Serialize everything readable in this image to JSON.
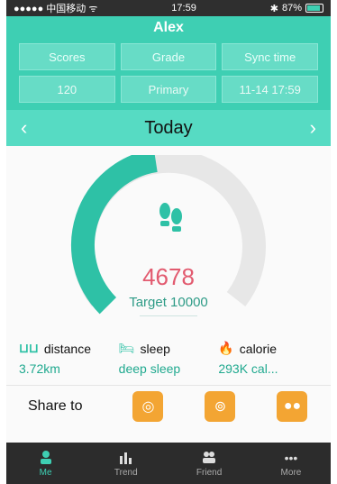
{
  "status": {
    "carrier": "●●●●● 中国移动 ᯤ",
    "time": "17:59",
    "battery": "87%"
  },
  "header": {
    "user": "Alex",
    "stats_headers": [
      "Scores",
      "Grade",
      "Sync time"
    ],
    "stats_values": [
      "120",
      "Primary",
      "11-14 17:59"
    ]
  },
  "date_bar": {
    "label": "Today",
    "prev": "‹",
    "next": "›"
  },
  "dashboard": {
    "steps": "4678",
    "target": "Target 10000",
    "progress_fraction": 0.468
  },
  "stats": {
    "distance": {
      "label": "distance",
      "value": "3.72km"
    },
    "sleep": {
      "label": "sleep",
      "value": "deep sleep"
    },
    "calorie": {
      "label": "calorie",
      "value": "293K cal..."
    }
  },
  "share": {
    "label": "Share to"
  },
  "tabbar": {
    "tabs": [
      "Me",
      "Trend",
      "Friend",
      "More"
    ]
  },
  "colors": {
    "accent": "#3ecfb3",
    "share": "#f3a533",
    "steps": "#e25a6f"
  }
}
